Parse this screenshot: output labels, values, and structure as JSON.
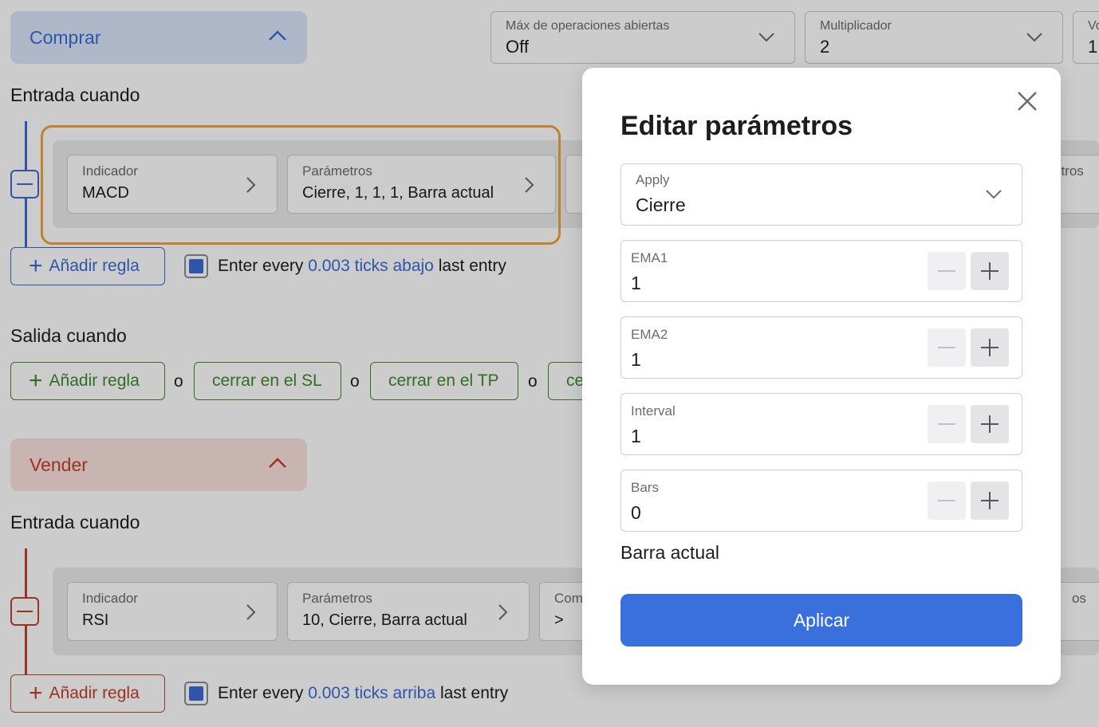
{
  "buy_section": {
    "header_label": "Comprar",
    "entry_title": "Entrada cuando",
    "rule": {
      "indicator_label": "Indicador",
      "indicator_value": "MACD",
      "params_label": "Parámetros",
      "params_value": "Cierre, 1, 1, 1, Barra actual",
      "params_partial": "etros"
    },
    "add_rule_label": "Añadir regla",
    "enter_every": {
      "prefix": "Enter every",
      "highlight": "0.003 ticks abajo",
      "suffix": "last entry",
      "checked": true
    },
    "exit_title": "Salida cuando",
    "exit_buttons": [
      "Añadir regla",
      "cerrar en el SL",
      "cerrar en el TP",
      "ce"
    ],
    "exit_separator": "o"
  },
  "sell_section": {
    "header_label": "Vender",
    "entry_title": "Entrada cuando",
    "rule": {
      "indicator_label": "Indicador",
      "indicator_value": "RSI",
      "params_label": "Parámetros",
      "params_value": "10, Cierre, Barra actual",
      "comp_label": "Com",
      "comp_value": ">",
      "params_partial": "os"
    },
    "add_rule_label": "Añadir regla",
    "enter_every": {
      "prefix": "Enter every",
      "highlight": "0.003 ticks arriba",
      "suffix": "last entry",
      "checked": true
    }
  },
  "top_dropdowns": [
    {
      "label": "Máx de operaciones abiertas",
      "value": "Off"
    },
    {
      "label": "Multiplicador",
      "value": "2"
    },
    {
      "label": "Vo",
      "value": "1"
    }
  ],
  "modal": {
    "title": "Editar parámetros",
    "apply_field": {
      "label": "Apply",
      "value": "Cierre"
    },
    "steppers": [
      {
        "label": "EMA1",
        "value": "1"
      },
      {
        "label": "EMA2",
        "value": "1"
      },
      {
        "label": "Interval",
        "value": "1"
      },
      {
        "label": "Bars",
        "value": "0"
      }
    ],
    "note": "Barra actual",
    "apply_button": "Aplicar"
  },
  "colors": {
    "accent_blue": "#3b6bd6",
    "buy_bg": "#dbe7fb",
    "sell_red": "#c3402a",
    "sell_bg": "#fbe1dc",
    "exit_green": "#3f8a2c",
    "highlight_orange": "#f0a23c",
    "apply_button": "#3a6fde"
  }
}
